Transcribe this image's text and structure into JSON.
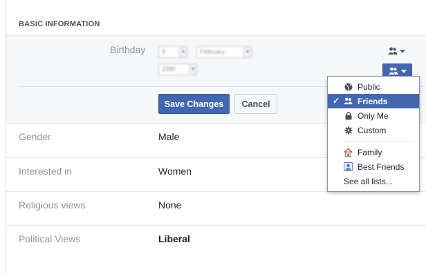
{
  "section": {
    "title": "BASIC INFORMATION"
  },
  "birthday": {
    "label": "Birthday",
    "day": "9",
    "month": "February",
    "year": "1990"
  },
  "buttons": {
    "save": "Save Changes",
    "cancel": "Cancel"
  },
  "audience": {
    "plain_icon": "friends-icon",
    "button_icon": "friends-icon",
    "colors": {
      "accent": "#4267b2"
    }
  },
  "menu": {
    "items": [
      {
        "label": "Public",
        "icon": "globe-icon",
        "selected": false
      },
      {
        "label": "Friends",
        "icon": "friends-icon",
        "selected": true
      },
      {
        "label": "Only Me",
        "icon": "lock-icon",
        "selected": false
      },
      {
        "label": "Custom",
        "icon": "gear-icon",
        "selected": false
      }
    ],
    "lists": [
      {
        "label": "Family",
        "icon": "house-icon"
      },
      {
        "label": "Best Friends",
        "icon": "person-card-icon"
      }
    ],
    "see_all": "See all lists..."
  },
  "fields": [
    {
      "label": "Gender",
      "value": "Male",
      "bold": false
    },
    {
      "label": "Interested in",
      "value": "Women",
      "bold": false
    },
    {
      "label": "Religious views",
      "value": "None",
      "bold": false
    },
    {
      "label": "Political Views",
      "value": "Liberal",
      "bold": true
    }
  ]
}
